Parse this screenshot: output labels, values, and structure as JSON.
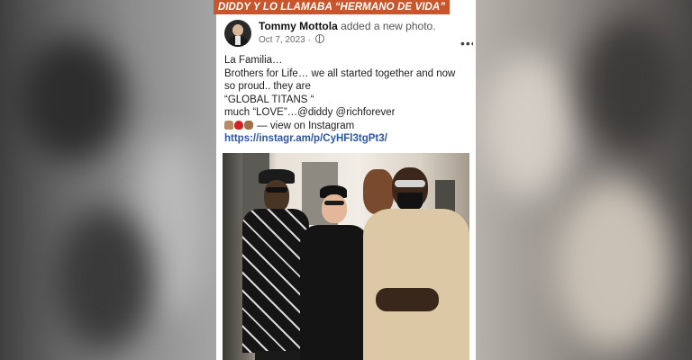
{
  "banner": {
    "text": "DIDDY Y LO LLAMABA “HERMANO DE VIDA”"
  },
  "post": {
    "author": "Tommy Mottola",
    "action": "added a new photo.",
    "date": "Oct 7, 2023 ·",
    "more_icon": "more-horizontal-icon",
    "lines": [
      "La Familia…",
      "Brothers for Life… we all started together and now",
      "so proud.. they are",
      "“GLOBAL TITANS “",
      "much “LOVE”…@diddy  @richforever"
    ],
    "instagram_text": "— view on Instagram",
    "link": "https://instagr.am/p/CyHFl3tgPt3/"
  },
  "colors": {
    "banner": "#c8552c",
    "link": "#2a57a8"
  }
}
